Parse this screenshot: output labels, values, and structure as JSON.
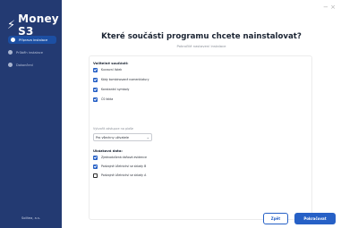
{
  "sidebar": {
    "logo_mark": "⚡",
    "logo_text": "Money S3",
    "steps": [
      {
        "label": "Příprava instalace",
        "active": true
      },
      {
        "label": "Průběh instalace",
        "active": false
      },
      {
        "label": "Dokončení",
        "active": false
      }
    ],
    "company": "Solitea, a.s."
  },
  "window": {
    "close_glyph": "− ×"
  },
  "header": {
    "title": "Které součásti programu chcete nainstalovat?",
    "subtitle": "Pokročilé nastavení instalace"
  },
  "optional": {
    "heading": "Volitelné součásti:",
    "items": [
      {
        "label": "Kurzovní lístek",
        "checked": true
      },
      {
        "label": "Kódy kombinované nomenklatury",
        "checked": true
      },
      {
        "label": "Konstantní symboly",
        "checked": true
      },
      {
        "label": "ČS fakta",
        "checked": true
      }
    ]
  },
  "shortcut": {
    "label": "Vytvořit zástupce na ploše",
    "selected": "Pro všechny uživatele"
  },
  "samples": {
    "heading": "Ukázková data:",
    "items": [
      {
        "label": "Zjednodušená daňová evidence",
        "checked": true
      },
      {
        "label": "Podvojné účetnictví se sklady B",
        "checked": true
      },
      {
        "label": "Podvojné účetnictví se sklady A",
        "checked": false
      }
    ]
  },
  "buttons": {
    "back": "Zpět",
    "next": "Pokračovat"
  },
  "colors": {
    "sidebar": "#233a72",
    "accent": "#2660c6",
    "active_step": "#1c4fa3"
  }
}
